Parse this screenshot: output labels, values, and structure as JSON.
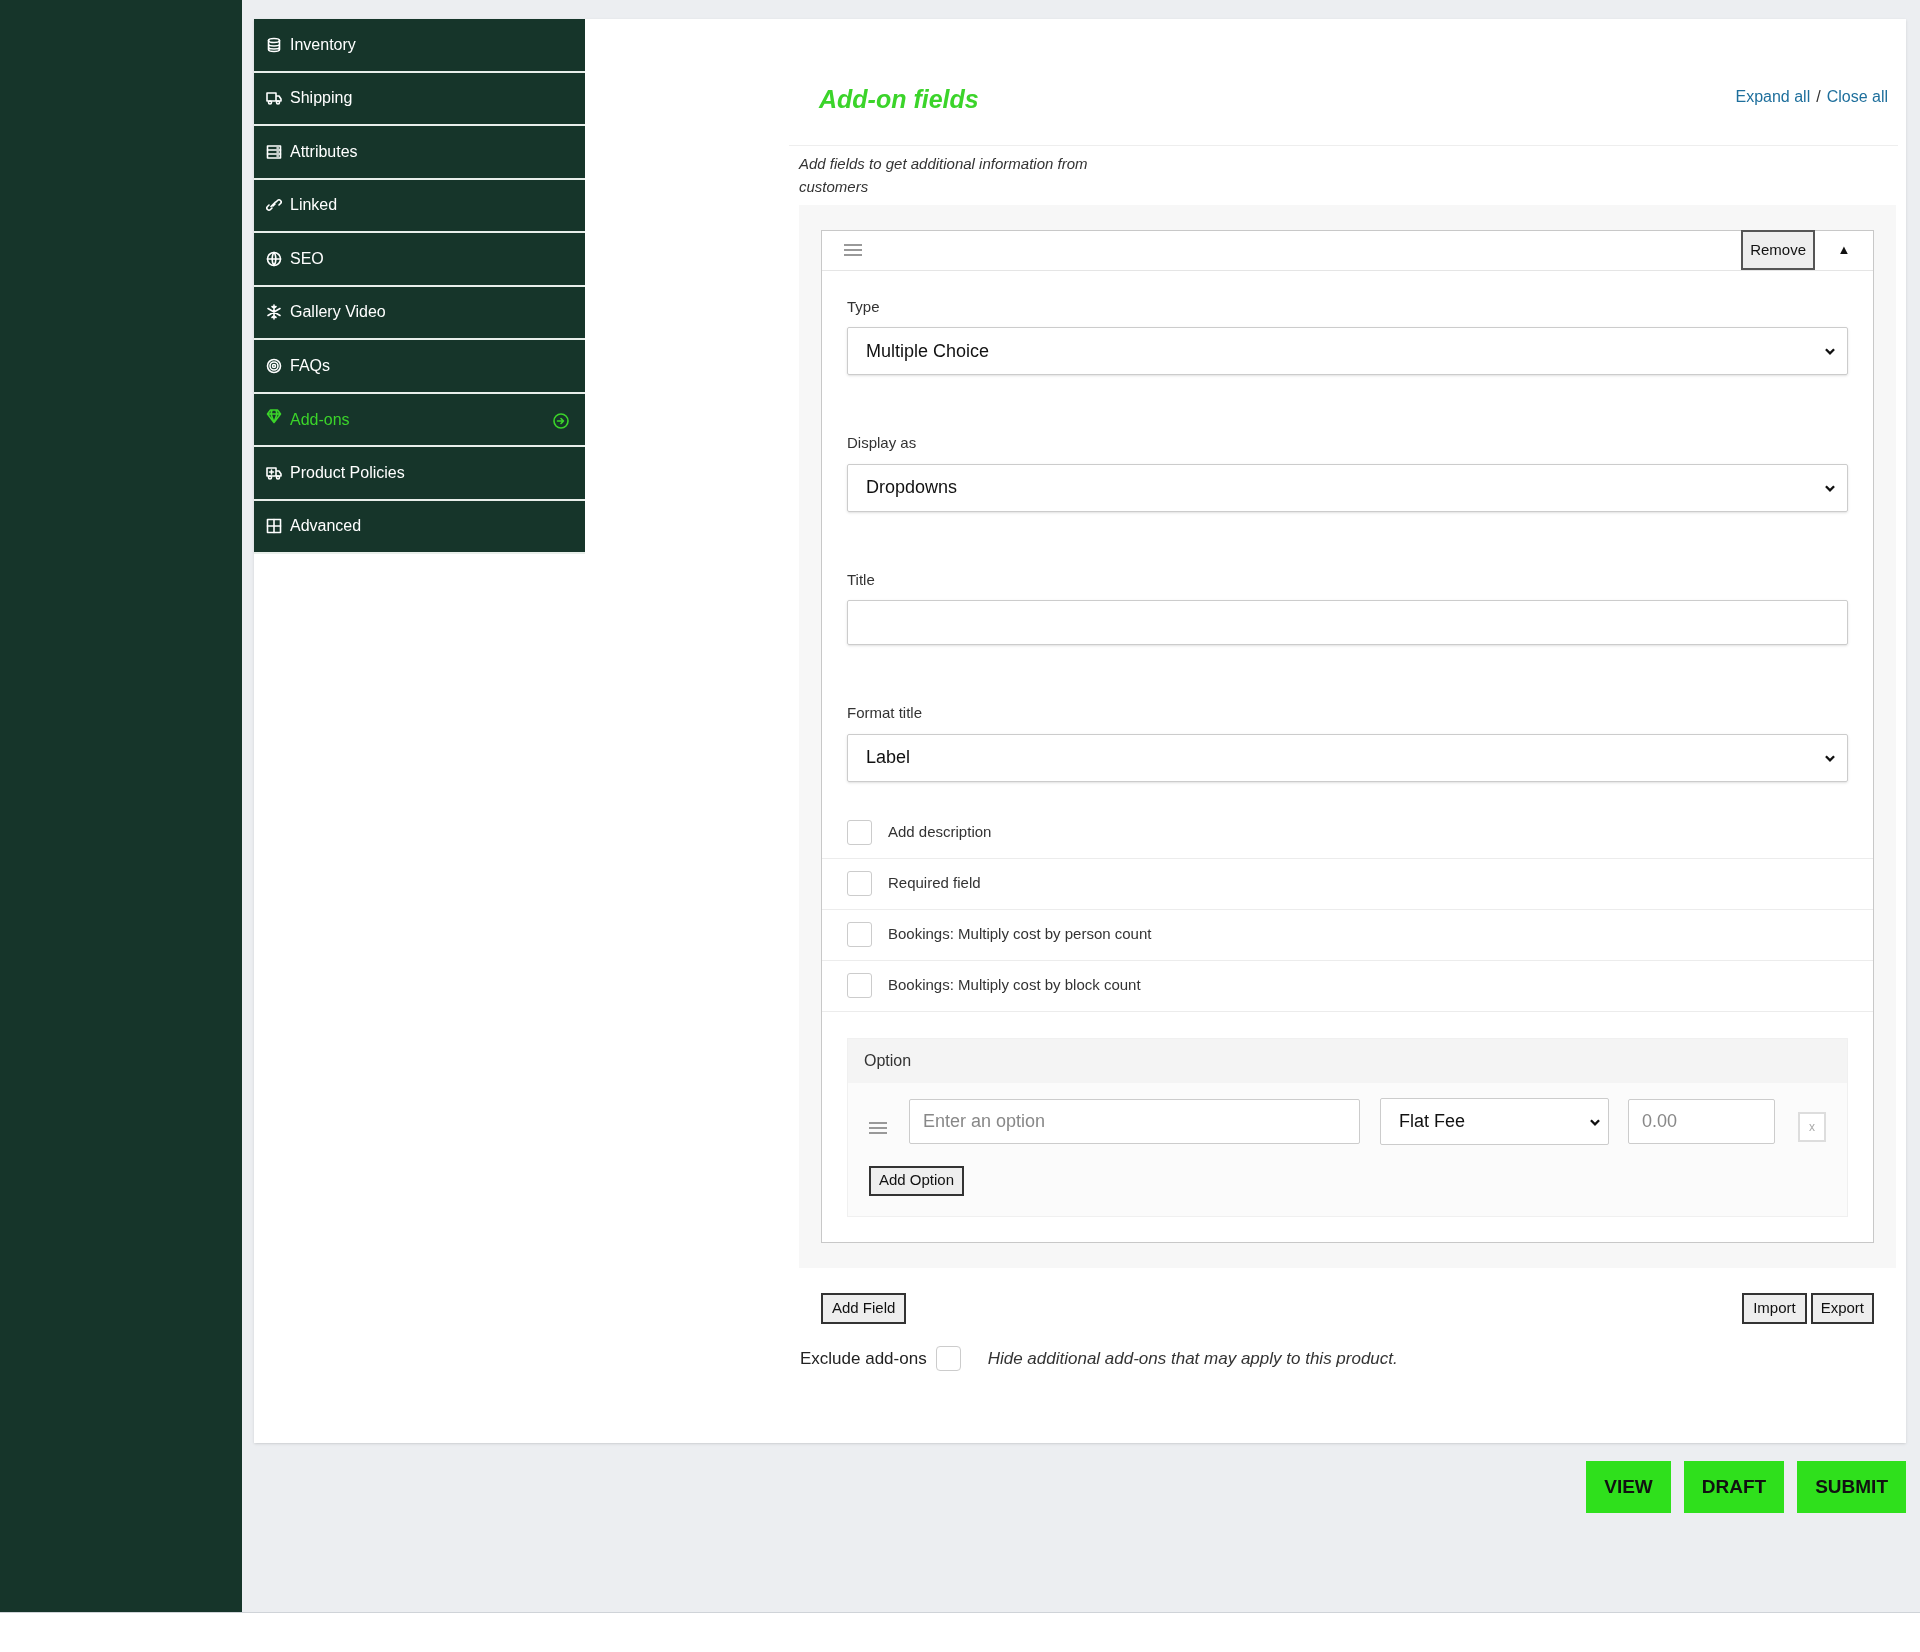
{
  "sidebar": {
    "items": [
      {
        "label": "Inventory",
        "selected": false
      },
      {
        "label": "Shipping",
        "selected": false
      },
      {
        "label": "Attributes",
        "selected": false
      },
      {
        "label": "Linked",
        "selected": false
      },
      {
        "label": "SEO",
        "selected": false
      },
      {
        "label": "Gallery Video",
        "selected": false
      },
      {
        "label": "FAQs",
        "selected": false
      },
      {
        "label": "Add-ons",
        "selected": true
      },
      {
        "label": "Product Policies",
        "selected": false
      },
      {
        "label": "Advanced",
        "selected": false
      }
    ]
  },
  "header": {
    "title": "Add-on fields",
    "expand_all": "Expand all",
    "separator": "/",
    "close_all": "Close all",
    "description": "Add fields to get additional information from customers"
  },
  "field": {
    "remove": "Remove",
    "collapse": "▲",
    "expanded": true,
    "selects": [
      {
        "label": "Type",
        "value": "Multiple Choice",
        "kind": "select"
      },
      {
        "label": "Display as",
        "value": "Dropdowns",
        "kind": "select"
      },
      {
        "label": "Title",
        "kind": "text"
      },
      {
        "label": "Format title",
        "value": "Label",
        "kind": "select"
      }
    ],
    "checkboxes": [
      {
        "label": "Add description",
        "checked": false
      },
      {
        "label": "Required field",
        "checked": false
      },
      {
        "label": "Bookings: Multiply cost by person count",
        "checked": false
      },
      {
        "label": "Bookings: Multiply cost by block count",
        "checked": false
      }
    ],
    "options": {
      "heading": "Option",
      "rows": [
        {
          "placeholder": "Enter an option",
          "price_type": "Flat Fee",
          "price_placeholder": "0.00",
          "remove": "x"
        }
      ],
      "add": "Add Option"
    }
  },
  "actions": {
    "add_field": "Add Field",
    "import": "Import",
    "export": "Export"
  },
  "exclude": {
    "label": "Exclude add-ons",
    "checked": false,
    "hint": "Hide additional add-ons that may apply to this product."
  },
  "footer_buttons": [
    "VIEW",
    "DRAFT",
    "SUBMIT"
  ]
}
